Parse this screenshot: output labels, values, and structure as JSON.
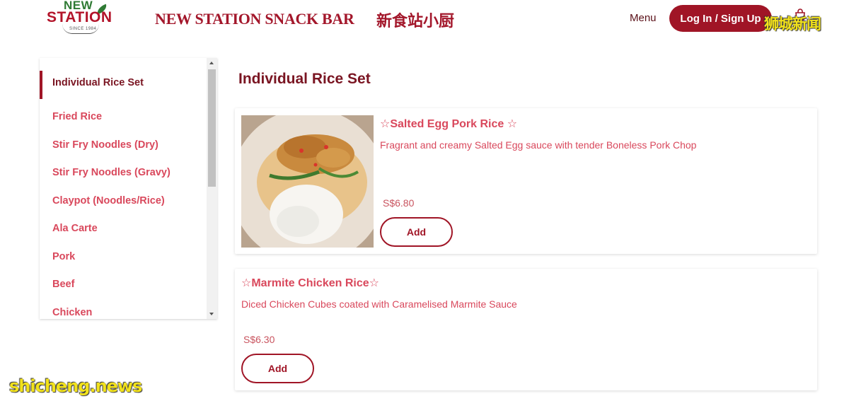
{
  "header": {
    "logo": {
      "top_text": "NEW",
      "main_text": "STATION",
      "since_text": "SINCE 1984"
    },
    "brand_en": "NEW STATION SNACK BAR",
    "brand_zh": "新食站小厨",
    "menu_label": "Menu",
    "login_label": "Log In / Sign Up",
    "cart_icon": "shopping-bag-icon"
  },
  "sidebar": {
    "items": [
      {
        "label": "Individual Rice Set",
        "active": true
      },
      {
        "label": "Fried Rice"
      },
      {
        "label": "Stir Fry Noodles (Dry)"
      },
      {
        "label": "Stir Fry Noodles (Gravy)"
      },
      {
        "label": "Claypot (Noodles/Rice)"
      },
      {
        "label": "Ala Carte"
      },
      {
        "label": "Pork"
      },
      {
        "label": "Beef"
      },
      {
        "label": "Chicken"
      }
    ]
  },
  "main": {
    "section_title": "Individual Rice Set",
    "items": [
      {
        "name": "☆Salted Egg Pork Rice ☆",
        "description": "Fragrant and creamy Salted Egg sauce with tender Boneless Pork Chop",
        "price": "S$6.80",
        "add_label": "Add"
      },
      {
        "name": "☆Marmite Chicken Rice☆",
        "description": "Diced Chicken Cubes coated with Caramelised Marmite Sauce",
        "price": "S$6.30",
        "add_label": "Add"
      }
    ]
  },
  "watermarks": {
    "top": "狮城新闻",
    "bottom": "shicheng.news"
  },
  "colors": {
    "primary": "#a01526",
    "title": "#7a1522",
    "accent_text": "#d9485c",
    "logo_green": "#2f7a34"
  }
}
